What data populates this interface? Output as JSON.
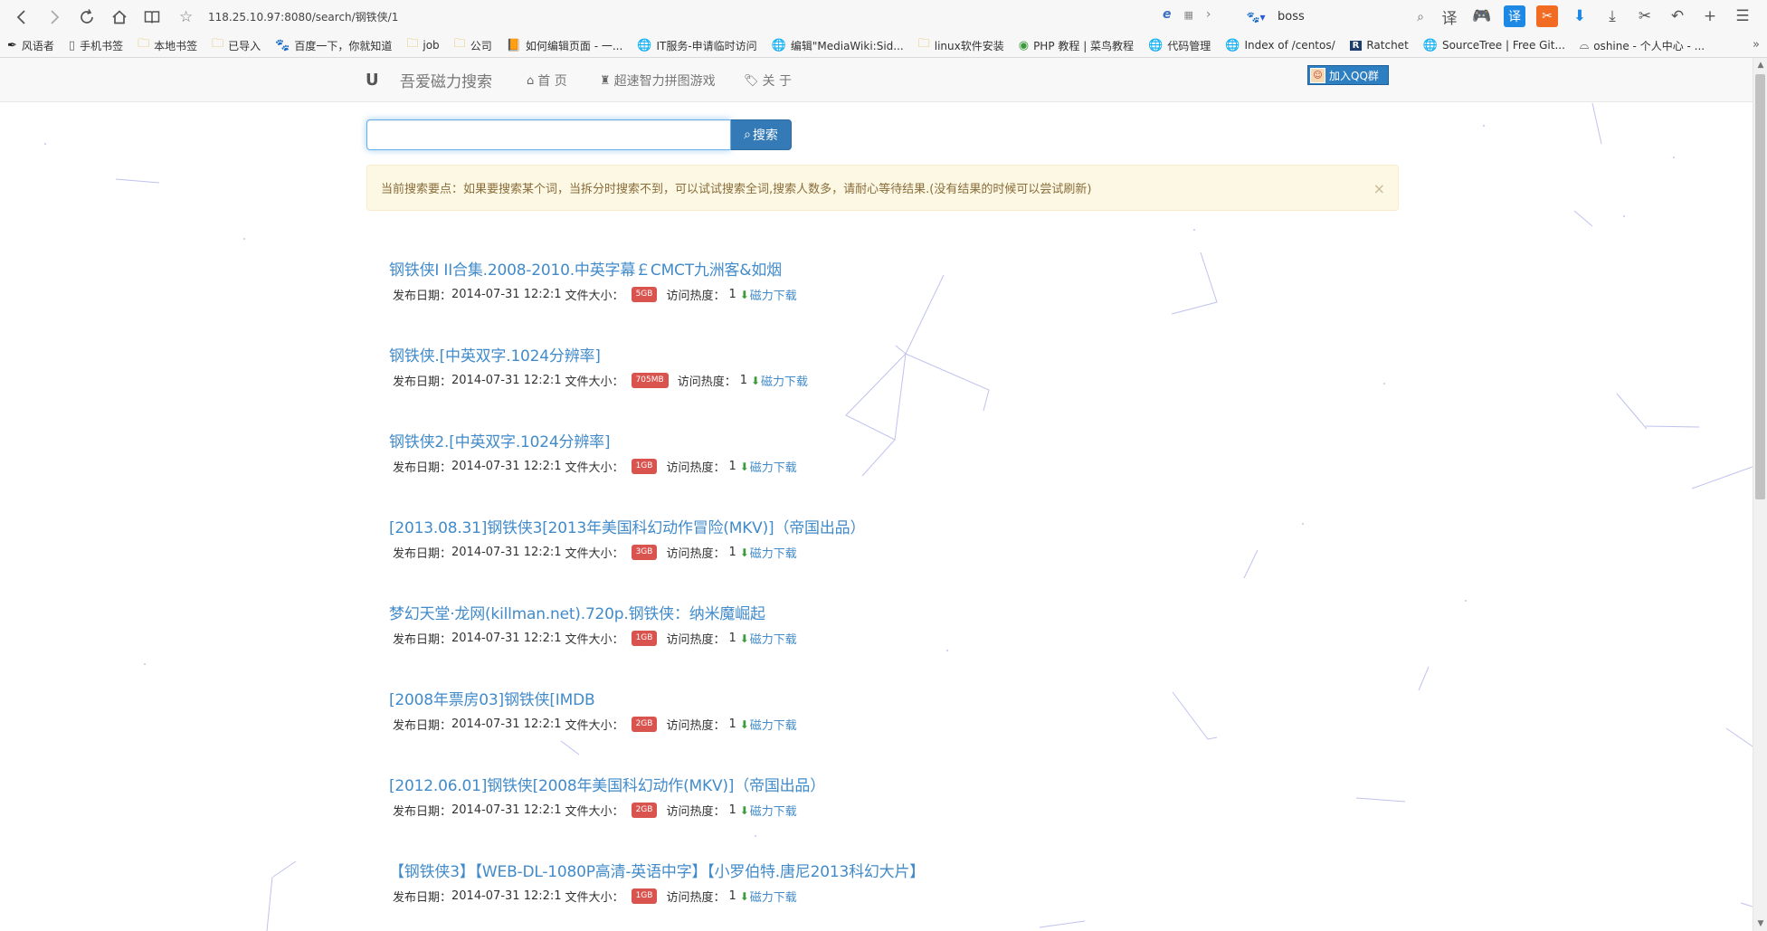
{
  "browser": {
    "url": "118.25.10.97:8080/search/钢铁侠/1",
    "search_query": "boss",
    "tool_translate": "译"
  },
  "bookmarks": [
    {
      "label": "风语者",
      "icon": "feather-icon"
    },
    {
      "label": "手机书签",
      "icon": "phone-icon"
    },
    {
      "label": "本地书签",
      "icon": "folder-icon"
    },
    {
      "label": "已导入",
      "icon": "folder-icon"
    },
    {
      "label": "百度一下，你就知道",
      "icon": "baidu-icon"
    },
    {
      "label": "job",
      "icon": "folder-icon"
    },
    {
      "label": "公司",
      "icon": "folder-icon"
    },
    {
      "label": "如何编辑页面 - 一...",
      "icon": "book-icon"
    },
    {
      "label": "IT服务-申请临时访问",
      "icon": "globe-icon"
    },
    {
      "label": "编辑\"MediaWiki:Sid...",
      "icon": "globe-icon"
    },
    {
      "label": "linux软件安装",
      "icon": "folder-icon"
    },
    {
      "label": "PHP 教程 | 菜鸟教程",
      "icon": "runoob-icon"
    },
    {
      "label": "代码管理",
      "icon": "globe-icon"
    },
    {
      "label": "Index of /centos/",
      "icon": "globe-icon"
    },
    {
      "label": "Ratchet",
      "icon": "ratchet-icon"
    },
    {
      "label": "SourceTree | Free Git...",
      "icon": "globe-icon"
    },
    {
      "label": "oshine - 个人中心 - ...",
      "icon": "oshine-icon"
    }
  ],
  "site": {
    "brand": "吾爱磁力搜索",
    "menu": [
      {
        "label": "首 页",
        "icon": "home-icon"
      },
      {
        "label": "超速智力拼图游戏",
        "icon": "chess-icon"
      },
      {
        "label": "关 于",
        "icon": "tags-icon"
      }
    ],
    "qq_button": "加入QQ群",
    "search_button": "搜索",
    "search_value": "",
    "alert": "当前搜索要点：如果要搜索某个词，当拆分时搜索不到，可以试试搜索全词,搜索人数多，请耐心等待结果.(没有结果的时候可以尝试刷新)"
  },
  "labels": {
    "date": "发布日期：",
    "size": "文件大小：",
    "hot": "访问热度：",
    "download": "磁力下载"
  },
  "results": [
    {
      "title": "钢铁侠I II合集.2008-2010.中英字幕￡CMCT九洲客&如烟",
      "date": "2014-07-31 12:2:1",
      "size": "5GB",
      "hot": "1"
    },
    {
      "title": "钢铁侠.[中英双字.1024分辨率]",
      "date": "2014-07-31 12:2:1",
      "size": "705MB",
      "hot": "1"
    },
    {
      "title": "钢铁侠2.[中英双字.1024分辨率]",
      "date": "2014-07-31 12:2:1",
      "size": "1GB",
      "hot": "1"
    },
    {
      "title": "[2013.08.31]钢铁侠3[2013年美国科幻动作冒险(MKV)]（帝国出品）",
      "date": "2014-07-31 12:2:1",
      "size": "3GB",
      "hot": "1"
    },
    {
      "title": "梦幻天堂·龙网(killman.net).720p.钢铁侠：纳米魔崛起",
      "date": "2014-07-31 12:2:1",
      "size": "1GB",
      "hot": "1"
    },
    {
      "title": "[2008年票房03]钢铁侠[IMDB",
      "date": "2014-07-31 12:2:1",
      "size": "2GB",
      "hot": "1"
    },
    {
      "title": "[2012.06.01]钢铁侠[2008年美国科幻动作(MKV)]（帝国出品）",
      "date": "2014-07-31 12:2:1",
      "size": "2GB",
      "hot": "1"
    },
    {
      "title": "【钢铁侠3】【WEB-DL-1080P高清-英语中字】【小罗伯特.唐尼2013科幻大片】",
      "date": "2014-07-31 12:2:1",
      "size": "1GB",
      "hot": "1"
    }
  ]
}
